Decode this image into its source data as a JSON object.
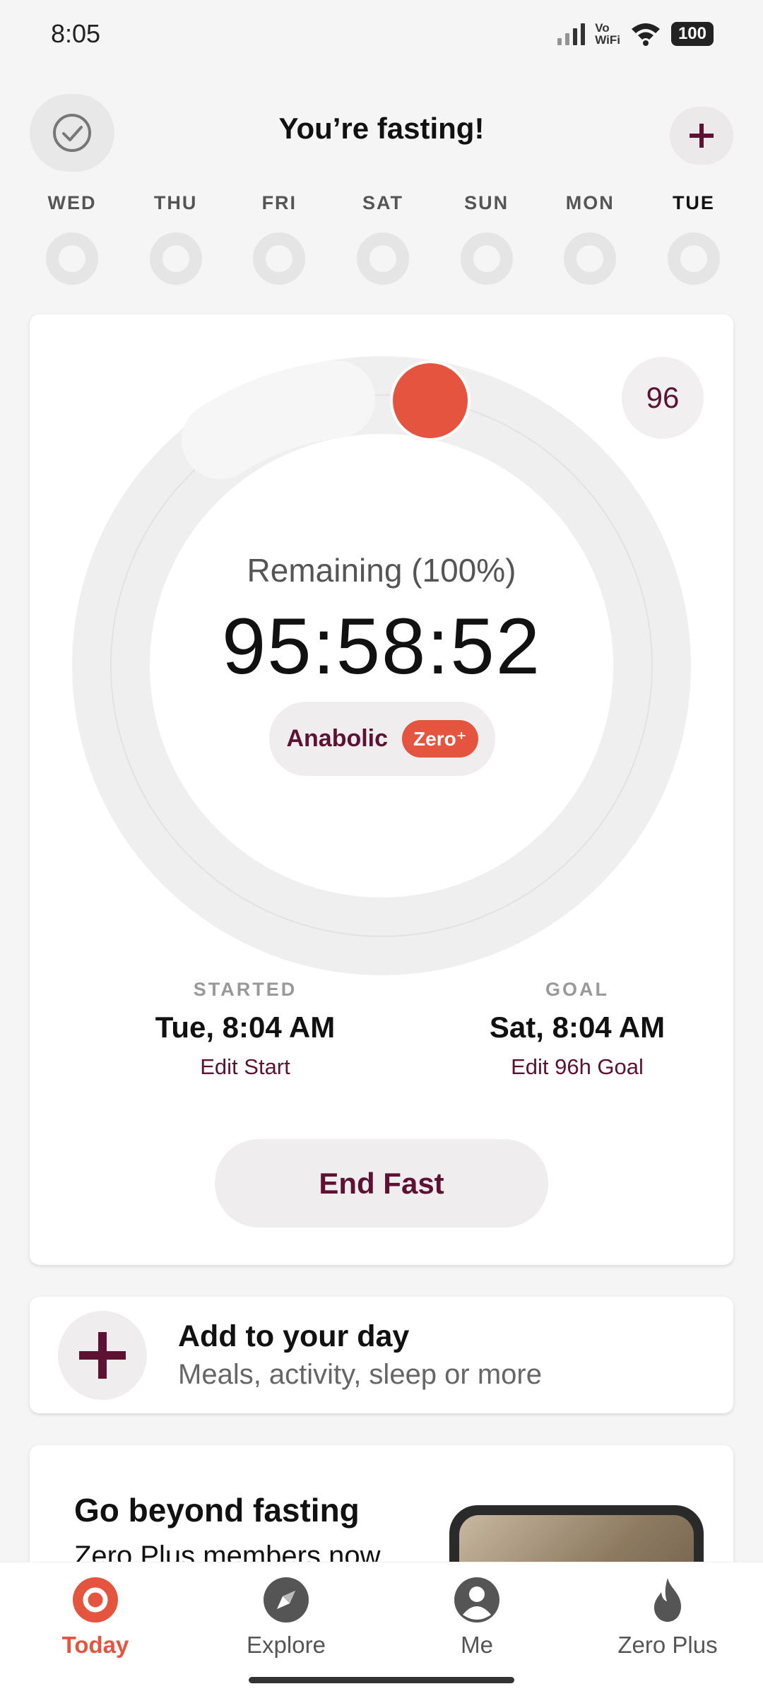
{
  "status_bar": {
    "time": "8:05",
    "network_label": "Vo\nWiFi",
    "battery": "100"
  },
  "header": {
    "title": "You’re fasting!",
    "left_icon": "check-circle-icon",
    "right_icon": "plus-icon"
  },
  "week": [
    {
      "label": "WED",
      "today": false
    },
    {
      "label": "THU",
      "today": false
    },
    {
      "label": "FRI",
      "today": false
    },
    {
      "label": "SAT",
      "today": false
    },
    {
      "label": "SUN",
      "today": false
    },
    {
      "label": "MON",
      "today": false
    },
    {
      "label": "TUE",
      "today": true
    }
  ],
  "timer_card": {
    "goal_hours": "96",
    "remaining_label": "Remaining (100%)",
    "remaining_percent": 100,
    "timer": "95:58:52",
    "phase": "Anabolic",
    "zero_plus_badge": "Zero⁺",
    "started_label": "STARTED",
    "started_value": "Tue, 8:04 AM",
    "edit_start": "Edit Start",
    "goal_label": "GOAL",
    "goal_value": "Sat, 8:04 AM",
    "edit_goal": "Edit 96h Goal",
    "end_button": "End Fast",
    "colors": {
      "accent": "#e4543f",
      "brand": "#5e1233",
      "track": "#efefef"
    }
  },
  "add_card": {
    "title": "Add to your day",
    "subtitle": "Meals, activity, sleep or more"
  },
  "promo_card": {
    "title": "Go beyond fasting",
    "subtitle": "Zero Plus members now"
  },
  "bottom_nav": [
    {
      "label": "Today",
      "icon": "today-icon",
      "active": true
    },
    {
      "label": "Explore",
      "icon": "compass-icon",
      "active": false
    },
    {
      "label": "Me",
      "icon": "profile-icon",
      "active": false
    },
    {
      "label": "Zero Plus",
      "icon": "flame-icon",
      "active": false
    }
  ]
}
